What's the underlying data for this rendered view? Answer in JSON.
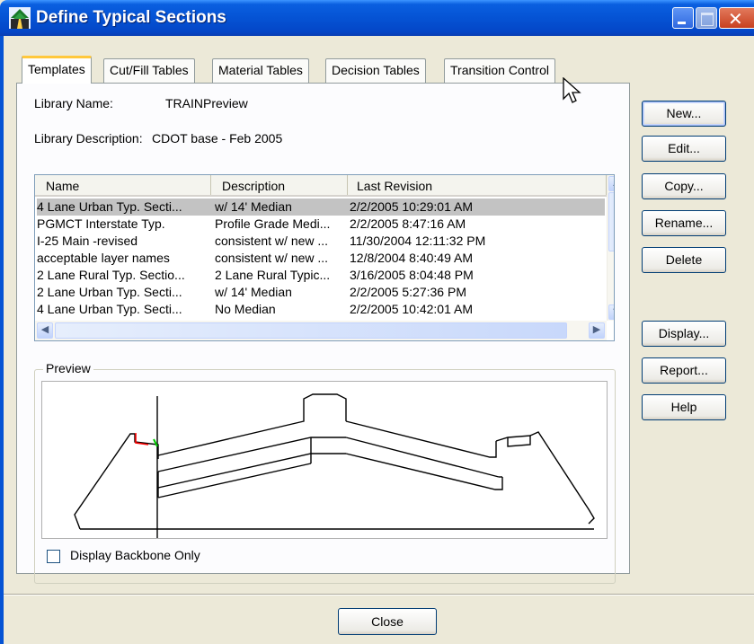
{
  "window": {
    "title": "Define Typical Sections"
  },
  "tabs": [
    {
      "label": "Templates",
      "active": true
    },
    {
      "label": "Cut/Fill Tables",
      "active": false
    },
    {
      "label": "Material Tables",
      "active": false
    },
    {
      "label": "Decision Tables",
      "active": false
    },
    {
      "label": "Transition Control",
      "active": false
    }
  ],
  "library": {
    "name_label": "Library Name:",
    "name_value": "TRAINPreview",
    "description_label": "Library Description:",
    "description_value": "CDOT base - Feb 2005"
  },
  "templates_list": {
    "columns": [
      "Name",
      "Description",
      "Last Revision"
    ],
    "rows": [
      {
        "name": "4 Lane Urban Typ. Secti...",
        "description": "w/ 14' Median",
        "revision": "2/2/2005 10:29:01 AM",
        "selected": true
      },
      {
        "name": "PGMCT Interstate Typ.",
        "description": "Profile Grade Medi...",
        "revision": "2/2/2005 8:47:16 AM",
        "selected": false
      },
      {
        "name": "I-25 Main -revised",
        "description": "consistent w/ new ...",
        "revision": "11/30/2004 12:11:32 PM",
        "selected": false
      },
      {
        "name": "acceptable layer names",
        "description": "consistent w/ new ...",
        "revision": "12/8/2004 8:40:49 AM",
        "selected": false
      },
      {
        "name": "2 Lane Rural Typ. Sectio...",
        "description": "2 Lane Rural Typic...",
        "revision": "3/16/2005 8:04:48 PM",
        "selected": false
      },
      {
        "name": "2 Lane Urban Typ. Secti...",
        "description": "w/ 14' Median",
        "revision": "2/2/2005 5:27:36 PM",
        "selected": false
      },
      {
        "name": "4 Lane Urban Typ. Secti...",
        "description": "No Median",
        "revision": "2/2/2005 10:42:01 AM",
        "selected": false
      }
    ]
  },
  "preview": {
    "group_label": "Preview",
    "backbone_only_label": "Display Backbone Only",
    "backbone_only_checked": false
  },
  "buttons": {
    "new": "New...",
    "edit": "Edit...",
    "copy": "Copy...",
    "rename": "Rename...",
    "delete": "Delete",
    "display": "Display...",
    "report": "Report...",
    "help": "Help",
    "close": "Close"
  },
  "colors": {
    "titlebar": "#0553d4",
    "active_tab_accent": "#ffc83c",
    "selected_row": "#c3c3c3",
    "preview_red": "#ff0000",
    "preview_green": "#00cc00"
  }
}
